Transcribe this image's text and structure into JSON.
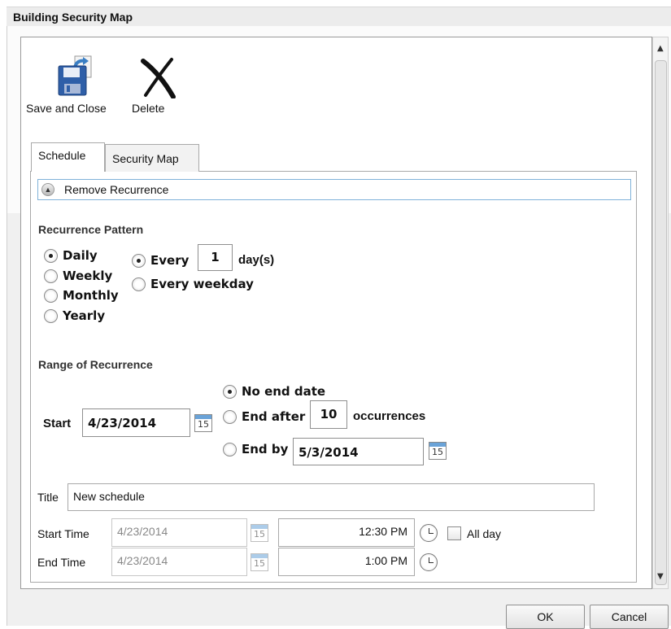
{
  "window": {
    "title": "Building Security Map"
  },
  "toolbar": {
    "save_close_label": "Save and Close",
    "save_icon": "floppy-save-icon",
    "delete_label": "Delete",
    "delete_icon": "x-delete-icon"
  },
  "tabs": [
    {
      "label": "Schedule",
      "active": true
    },
    {
      "label": "Security Map",
      "active": false
    }
  ],
  "recurrence_toggle": {
    "label": "Remove Recurrence",
    "icon": "chevron-up-icon"
  },
  "pattern": {
    "heading": "Recurrence Pattern",
    "frequencies": [
      {
        "label": "Daily",
        "selected": true
      },
      {
        "label": "Weekly",
        "selected": false
      },
      {
        "label": "Monthly",
        "selected": false
      },
      {
        "label": "Yearly",
        "selected": false
      }
    ],
    "daily": {
      "every_label": "Every",
      "every_value": "1",
      "unit_label": "day(s)",
      "every_selected": true,
      "weekday_label": "Every weekday",
      "weekday_selected": false
    }
  },
  "range": {
    "heading": "Range of Recurrence",
    "start_label": "Start",
    "start_value": "4/23/2014",
    "no_end_label": "No end date",
    "no_end_selected": true,
    "end_after_label": "End after",
    "end_after_value": "10",
    "occurrences_label": "occurrences",
    "end_by_label": "End by",
    "end_by_value": "5/3/2014",
    "calendar_day": "15"
  },
  "event": {
    "title_label": "Title",
    "title_value": "New schedule",
    "start_time_label": "Start Time",
    "start_date": "4/23/2014",
    "start_time": "12:30 PM",
    "all_day_label": "All day",
    "all_day_checked": false,
    "end_time_label": "End Time",
    "end_date": "4/23/2014",
    "end_time": "1:00 PM"
  },
  "footer": {
    "ok_label": "OK",
    "cancel_label": "Cancel"
  },
  "colors": {
    "accent": "#6aa3d8",
    "toggle_border": "#7fb2d9"
  }
}
